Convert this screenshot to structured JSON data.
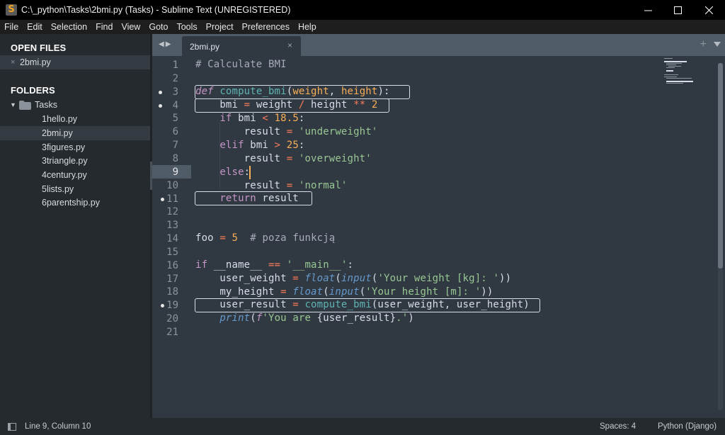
{
  "window": {
    "title": "C:\\_python\\Tasks\\2bmi.py (Tasks) - Sublime Text (UNREGISTERED)",
    "app_icon": "sublime-text-icon",
    "controls": {
      "minimize": "─",
      "maximize": "☐",
      "close": "✕"
    }
  },
  "menu": {
    "items": [
      "File",
      "Edit",
      "Selection",
      "Find",
      "View",
      "Goto",
      "Tools",
      "Project",
      "Preferences",
      "Help"
    ]
  },
  "sidebar": {
    "open_files_header": "OPEN FILES",
    "open_files": [
      {
        "name": "2bmi.py",
        "close_icon": "×"
      }
    ],
    "folders_header": "FOLDERS",
    "folder": {
      "name": "Tasks",
      "expanded_icon": "▼",
      "folder_icon": "folder-icon"
    },
    "files": [
      "1hello.py",
      "2bmi.py",
      "3figures.py",
      "3triangle.py",
      "4century.py",
      "5lists.py",
      "6parentship.py"
    ],
    "selected_file": "2bmi.py"
  },
  "tabs": {
    "nav_left": "◀",
    "nav_right": "▶",
    "active": {
      "label": "2bmi.py",
      "close": "×"
    },
    "new_tab": "+",
    "menu_icon": "triangle-down-icon"
  },
  "editor": {
    "current_line": 9,
    "cursor_column": 10,
    "lines": [
      {
        "n": "1"
      },
      {
        "n": "2"
      },
      {
        "n": "3",
        "mark": true
      },
      {
        "n": "4",
        "mark": true
      },
      {
        "n": "5"
      },
      {
        "n": "6"
      },
      {
        "n": "7"
      },
      {
        "n": "8"
      },
      {
        "n": "9"
      },
      {
        "n": "10"
      },
      {
        "n": "11",
        "mark": true
      },
      {
        "n": "12"
      },
      {
        "n": "13"
      },
      {
        "n": "14"
      },
      {
        "n": "15"
      },
      {
        "n": "16"
      },
      {
        "n": "17"
      },
      {
        "n": "18"
      },
      {
        "n": "19",
        "mark": true
      },
      {
        "n": "20"
      },
      {
        "n": "21"
      }
    ],
    "code": {
      "l1": [
        "# Calculate BMI"
      ],
      "l3": [
        "def",
        " ",
        "compute_bmi",
        "(",
        "weight",
        ", ",
        "height",
        "):"
      ],
      "l4": [
        "    bmi ",
        "=",
        " weight ",
        "/",
        " height ",
        "**",
        " ",
        "2"
      ],
      "l5": [
        "    ",
        "if",
        " bmi ",
        "<",
        " ",
        "18.5",
        ":"
      ],
      "l6": [
        "        result ",
        "=",
        " ",
        "'underweight'"
      ],
      "l7": [
        "    ",
        "elif",
        " bmi ",
        ">",
        " ",
        "25",
        ":"
      ],
      "l8": [
        "        result ",
        "=",
        " ",
        "'overweight'"
      ],
      "l9": [
        "    ",
        "else",
        ":"
      ],
      "l10": [
        "        result ",
        "=",
        " ",
        "'normal'"
      ],
      "l11": [
        "    ",
        "return",
        " result"
      ],
      "l14": [
        "foo ",
        "=",
        " ",
        "5",
        "  ",
        "# poza funkcją"
      ],
      "l16": [
        "if",
        " __name__ ",
        "==",
        " ",
        "'__main__'",
        ":"
      ],
      "l17": [
        "    user_weight ",
        "=",
        " ",
        "float",
        "(",
        "input",
        "(",
        "'Your weight [kg]: '",
        "))"
      ],
      "l18": [
        "    my_height ",
        "=",
        " ",
        "float",
        "(",
        "input",
        "(",
        "'Your height [m]: '",
        "))"
      ],
      "l19": [
        "    user_result ",
        "=",
        " ",
        "compute_bmi",
        "(user_weight, user_height)"
      ],
      "l20": [
        "    ",
        "print",
        "(",
        "f",
        "'You are ",
        "{user_result}",
        ".'",
        ")"
      ]
    }
  },
  "status": {
    "panel_icon": "panel-toggle-icon",
    "position": "Line 9, Column 10",
    "indent": "Spaces: 4",
    "syntax": "Python (Django)"
  }
}
